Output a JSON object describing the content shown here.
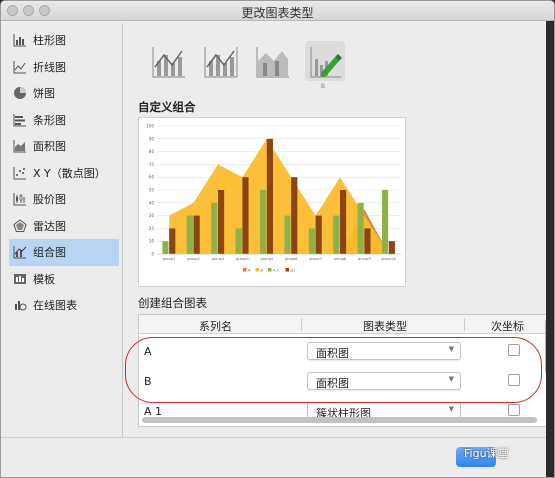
{
  "window": {
    "title": "更改图表类型"
  },
  "sidebar": {
    "items": [
      {
        "label": "柱形图",
        "icon": "column-chart-icon"
      },
      {
        "label": "折线图",
        "icon": "line-chart-icon"
      },
      {
        "label": "饼图",
        "icon": "pie-chart-icon"
      },
      {
        "label": "条形图",
        "icon": "bar-chart-icon"
      },
      {
        "label": "面积图",
        "icon": "area-chart-icon"
      },
      {
        "label": "X Y（散点图）",
        "icon": "scatter-chart-icon"
      },
      {
        "label": "股价图",
        "icon": "stock-chart-icon"
      },
      {
        "label": "雷达图",
        "icon": "radar-chart-icon"
      },
      {
        "label": "组合图",
        "icon": "combo-chart-icon",
        "active": true
      },
      {
        "label": "模板",
        "icon": "template-icon"
      },
      {
        "label": "在线图表",
        "icon": "online-chart-icon"
      }
    ]
  },
  "combo_types": [
    {
      "icon": "combo-column-line-icon"
    },
    {
      "icon": "combo-column-line-secondary-icon"
    },
    {
      "icon": "combo-stacked-area-column-icon"
    },
    {
      "icon": "custom-combo-icon",
      "selected": true,
      "note": "B"
    }
  ],
  "sections": {
    "custom_combo": "自定义组合",
    "create_combo": "创建组合图表"
  },
  "chart_data": {
    "type": "bar",
    "categories": [
      "group1",
      "group2",
      "group3",
      "group4",
      "group5",
      "group6",
      "group7",
      "group8",
      "group9",
      "group10"
    ],
    "ylim": [
      0,
      100
    ],
    "yticks": [
      "0",
      "10",
      "20",
      "30",
      "40",
      "50",
      "60",
      "70",
      "80",
      "90",
      "100"
    ],
    "series": [
      {
        "name": "A",
        "type": "area",
        "color": "#e07a3a",
        "values": [
          0,
          0,
          0,
          0,
          0,
          0,
          0,
          0,
          35,
          0
        ]
      },
      {
        "name": "B",
        "type": "area",
        "color": "#fbbd2d",
        "values": [
          30,
          40,
          70,
          60,
          90,
          60,
          30,
          60,
          30,
          0
        ]
      },
      {
        "name": "A 1",
        "type": "bar",
        "color": "#8fb14a",
        "values": [
          10,
          30,
          40,
          20,
          50,
          30,
          20,
          30,
          40,
          50
        ]
      },
      {
        "name": "B1",
        "type": "bar",
        "color": "#8b4513",
        "values": [
          20,
          30,
          50,
          60,
          90,
          60,
          30,
          50,
          20,
          10
        ]
      }
    ],
    "legend": "bottom",
    "grid": true
  },
  "table": {
    "headers": [
      "系列名",
      "图表类型",
      "次坐标"
    ],
    "rows": [
      {
        "name": "A",
        "type": "面积图"
      },
      {
        "name": "B",
        "type": "面积图"
      },
      {
        "name": "A 1",
        "type": "簇状柱形图"
      }
    ]
  },
  "footer": {
    "watermark": "Figu课堂"
  },
  "colors": {
    "accent": "#2f84ee",
    "highlight": "#d22b2b",
    "selected": "#b7d4f5"
  }
}
